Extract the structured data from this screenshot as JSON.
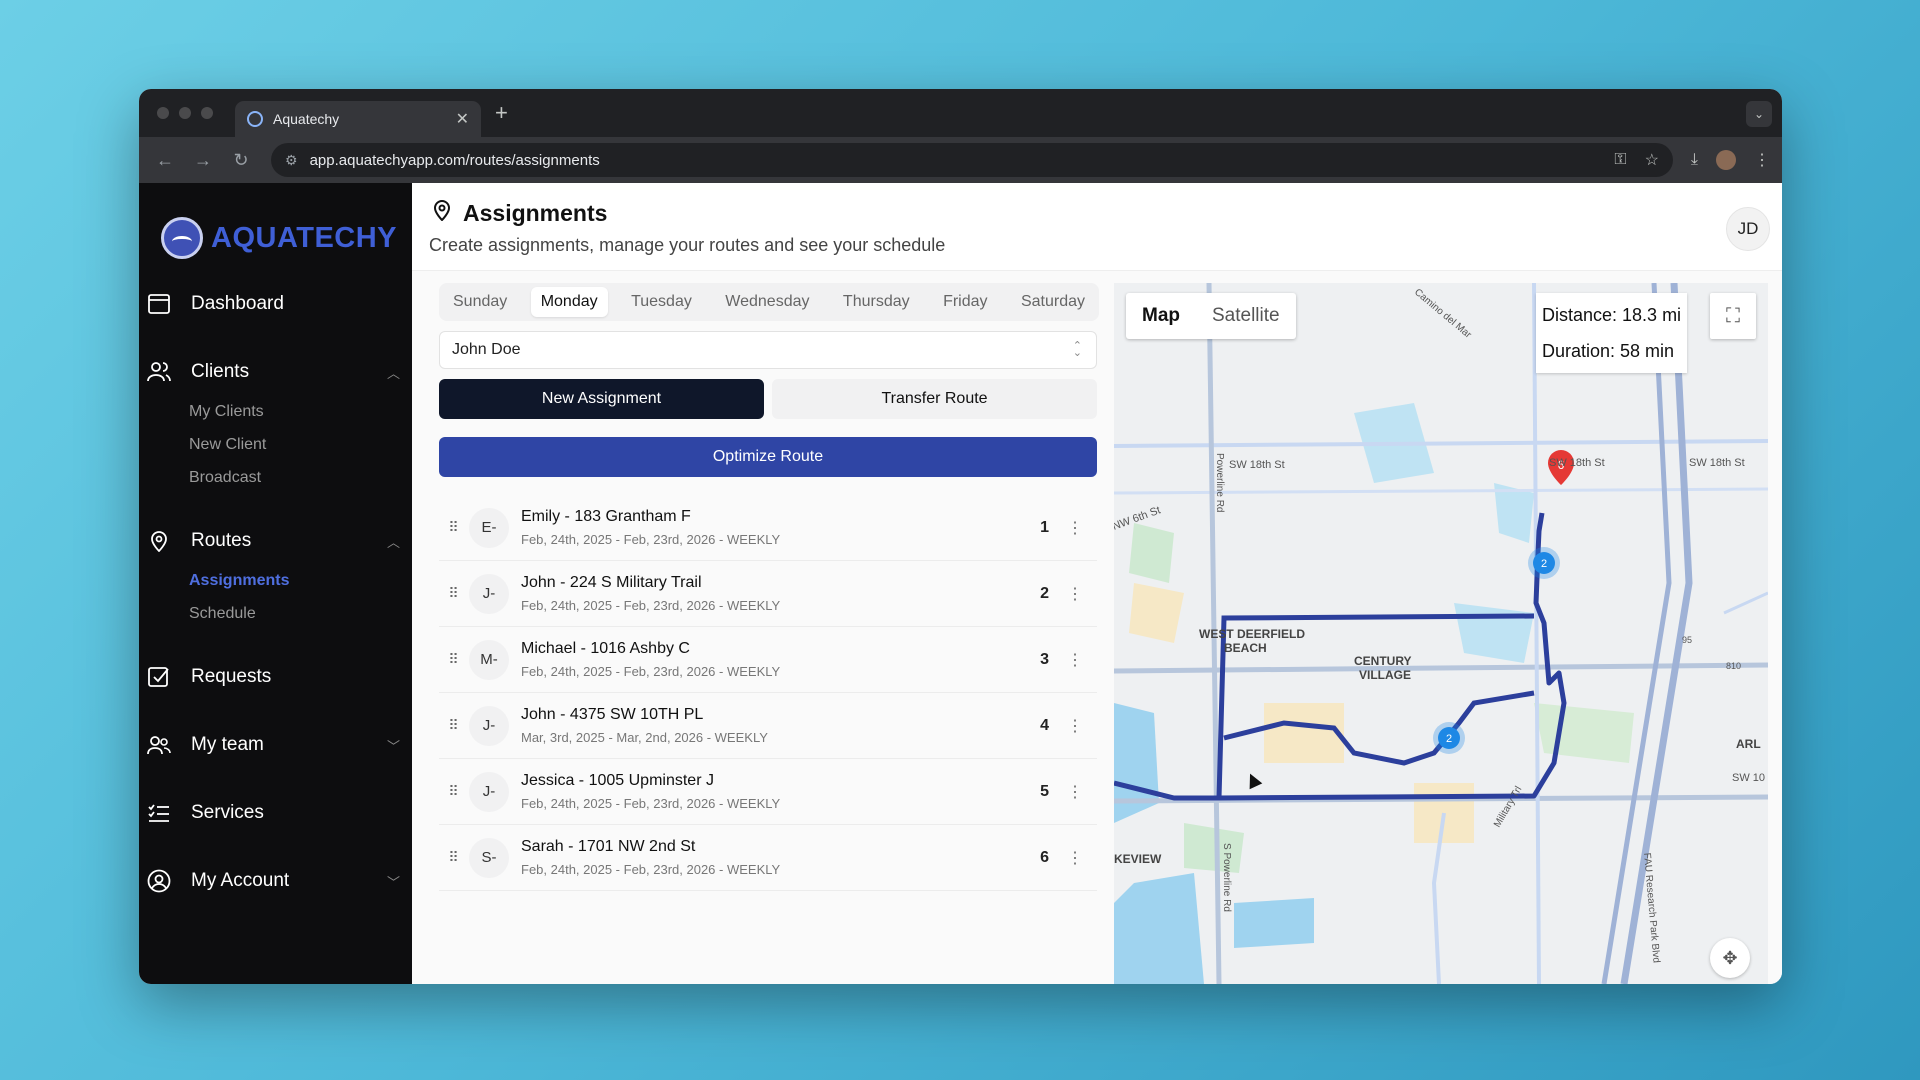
{
  "browser": {
    "tab_title": "Aquatechy",
    "url": "app.aquatechyapp.com/routes/assignments"
  },
  "sidebar": {
    "logo_text": "AQUATECHY",
    "dashboard": "Dashboard",
    "clients": "Clients",
    "clients_sub": [
      "My Clients",
      "New Client",
      "Broadcast"
    ],
    "routes": "Routes",
    "routes_sub": [
      "Assignments",
      "Schedule"
    ],
    "requests": "Requests",
    "my_team": "My team",
    "services": "Services",
    "my_account": "My Account"
  },
  "header": {
    "title": "Assignments",
    "subtitle": "Create assignments, manage your routes and see your schedule",
    "avatar": "JD"
  },
  "days": [
    "Sunday",
    "Monday",
    "Tuesday",
    "Wednesday",
    "Thursday",
    "Friday",
    "Saturday"
  ],
  "selected_day": "Monday",
  "technician": "John Doe",
  "buttons": {
    "new_assignment": "New Assignment",
    "transfer_route": "Transfer Route",
    "optimize_route": "Optimize Route"
  },
  "assignments": [
    {
      "initial": "E-",
      "title": "Emily - 183 Grantham F",
      "dates": "Feb, 24th, 2025 - Feb, 23rd, 2026 - WEEKLY",
      "order": "1"
    },
    {
      "initial": "J-",
      "title": "John - 224 S Military Trail",
      "dates": "Feb, 24th, 2025 - Feb, 23rd, 2026 - WEEKLY",
      "order": "2"
    },
    {
      "initial": "M-",
      "title": "Michael - 1016 Ashby C",
      "dates": "Feb, 24th, 2025 - Feb, 23rd, 2026 - WEEKLY",
      "order": "3"
    },
    {
      "initial": "J-",
      "title": "John - 4375 SW 10TH PL",
      "dates": "Mar, 3rd, 2025 - Mar, 2nd, 2026 - WEEKLY",
      "order": "4"
    },
    {
      "initial": "J-",
      "title": "Jessica - 1005 Upminster J",
      "dates": "Feb, 24th, 2025 - Feb, 23rd, 2026 - WEEKLY",
      "order": "5"
    },
    {
      "initial": "S-",
      "title": "Sarah - 1701 NW 2nd St",
      "dates": "Feb, 24th, 2025 - Feb, 23rd, 2026 - WEEKLY",
      "order": "6"
    }
  ],
  "map": {
    "tab_map": "Map",
    "tab_satellite": "Satellite",
    "distance": "Distance: 18.3 mi",
    "duration": "Duration: 58 min",
    "labels": {
      "sw18_a": "SW 18th St",
      "sw18_b": "SW 18th St",
      "sw18_c": "SW 18th St",
      "nw6": "NW 6th St",
      "west_deerfield_1": "WEST DEERFIELD",
      "west_deerfield_2": "BEACH",
      "century_1": "CENTURY",
      "century_2": "VILLAGE",
      "keview": "KEVIEW",
      "arl": "ARL",
      "sw10": "SW 10",
      "powerline": "Powerline Rd",
      "s_powerline": "S Powerline Rd",
      "military": "Military Trl",
      "fau": "FAU Research Park Blvd",
      "camino": "Camino del Mar",
      "i95": "95",
      "r810": "810",
      "marker_6": "6",
      "marker_2a": "2",
      "marker_2b": "2"
    }
  }
}
